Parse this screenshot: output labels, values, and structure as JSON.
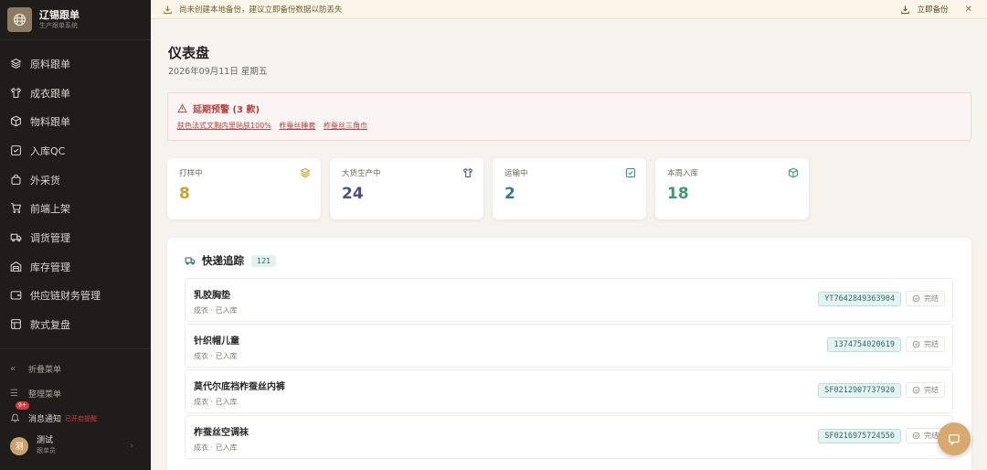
{
  "app": {
    "name": "辽锡跟单",
    "subtitle": "生产跟单系统"
  },
  "sidebar": {
    "items": [
      {
        "label": "原料跟单",
        "icon": "layers-icon"
      },
      {
        "label": "成衣跟单",
        "icon": "shirt-icon"
      },
      {
        "label": "物料跟单",
        "icon": "box-icon"
      },
      {
        "label": "入库QC",
        "icon": "checkbox-icon"
      },
      {
        "label": "外采货",
        "icon": "bag-icon"
      },
      {
        "label": "前端上架",
        "icon": "cart-icon"
      },
      {
        "label": "调货管理",
        "icon": "truck-icon"
      },
      {
        "label": "库存管理",
        "icon": "warehouse-icon"
      },
      {
        "label": "供应链财务管理",
        "icon": "wallet-icon"
      },
      {
        "label": "款式复盘",
        "icon": "table-icon"
      }
    ],
    "collapse_label": "折叠菜单",
    "organize_label": "整理菜单",
    "notify_label": "消息通知",
    "notify_badge": "9+",
    "notify_warning": "已开启提醒",
    "user": {
      "avatar": "测",
      "name": "测试",
      "role": "跟单员"
    }
  },
  "notice": {
    "text": "尚未创建本地备份，建议立即备份数据以防丢失",
    "backup_label": "立即备份"
  },
  "page": {
    "title": "仪表盘",
    "date": "2026年09月11日 星期五"
  },
  "alert": {
    "title": "延期预警 (3 款)",
    "links": [
      "肤色法式文胸内里贴肤100%",
      "柞蚕丝睡套",
      "柞蚕丝三角巾"
    ]
  },
  "stats": [
    {
      "label": "打样中",
      "value": "8",
      "color": "#c9a227",
      "icon": "layers-icon"
    },
    {
      "label": "大货生产中",
      "value": "24",
      "color": "#4a4e8c",
      "icon": "shirt-icon"
    },
    {
      "label": "运输中",
      "value": "2",
      "color": "#2f7f8a",
      "icon": "checkbox-icon"
    },
    {
      "label": "本周入库",
      "value": "18",
      "color": "#3f9a6e",
      "icon": "box-icon"
    }
  ],
  "tracking": {
    "title": "快递追踪",
    "count": "121",
    "rows": [
      {
        "name": "乳胶胸垫",
        "meta": "成衣 · 已入库",
        "number": "YT7642849363904",
        "status": "完结"
      },
      {
        "name": "针织帽儿童",
        "meta": "成衣 · 已入库",
        "number": "1374754020619",
        "status": "完结"
      },
      {
        "name": "莫代尔底裆柞蚕丝内裤",
        "meta": "成衣 · 已入库",
        "number": "SF0212907737920",
        "status": "完结"
      },
      {
        "name": "柞蚕丝空调袜",
        "meta": "成衣 · 已入库",
        "number": "SF0216975724556",
        "status": "完结"
      }
    ]
  },
  "colors": {
    "sidebar_bg": "#1f1d1b",
    "accent": "#d9a86c",
    "alert": "#b3413f",
    "teal": "#2f6f68"
  }
}
